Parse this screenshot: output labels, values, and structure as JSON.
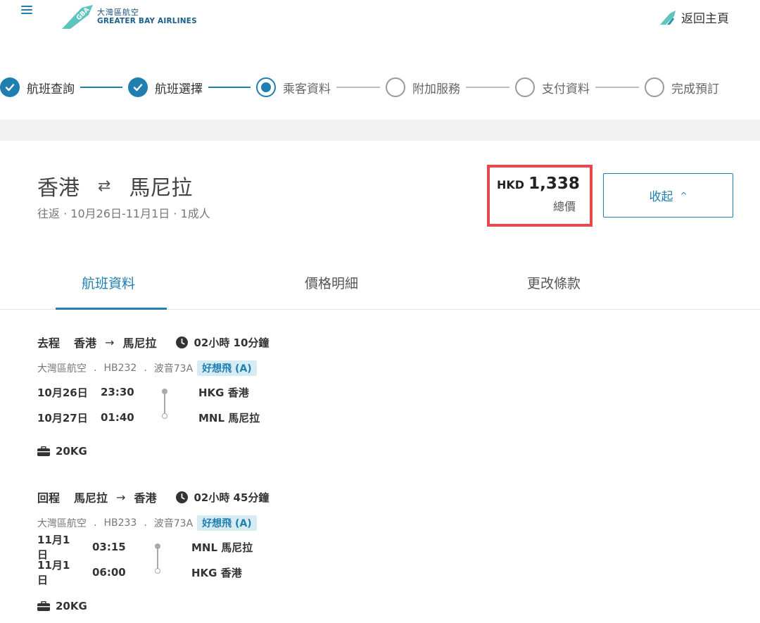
{
  "header": {
    "logo_cn": "大灣區航空",
    "logo_en": "GREATER BAY AIRLINES",
    "logo_mark": "GBA",
    "home_label": "返回主頁"
  },
  "stepper": {
    "steps": [
      {
        "label": "航班查詢",
        "state": "done"
      },
      {
        "label": "航班選擇",
        "state": "done"
      },
      {
        "label": "乘客資料",
        "state": "current"
      },
      {
        "label": "附加服務",
        "state": "pending"
      },
      {
        "label": "支付資料",
        "state": "pending"
      },
      {
        "label": "完成預訂",
        "state": "pending"
      }
    ]
  },
  "summary": {
    "origin": "香港",
    "swap_icon": "⇄",
    "destination": "馬尼拉",
    "subtitle": "往返 · 10月26日-11月1日 · 1成人",
    "currency": "HKD",
    "amount": "1,338",
    "price_label": "總價",
    "collapse_label": "收起",
    "collapse_chevron": "^"
  },
  "tabs": [
    {
      "label": "航班資料",
      "active": true
    },
    {
      "label": "價格明細",
      "active": false
    },
    {
      "label": "更改條款",
      "active": false
    }
  ],
  "outbound": {
    "direction": "去程",
    "from": "香港",
    "arrow": "→",
    "to": "馬尼拉",
    "duration": "02小時 10分鐘",
    "airline": "大灣區航空",
    "sep": ".",
    "flight_no": "HB232",
    "aircraft": "波音73A",
    "fare": "好想飛 (A)",
    "dep_date": "10月26日",
    "dep_time": "23:30",
    "dep_airport": "HKG 香港",
    "arr_date": "10月27日",
    "arr_time": "01:40",
    "arr_airport": "MNL 馬尼拉",
    "baggage": "20KG"
  },
  "inbound": {
    "direction": "回程",
    "from": "馬尼拉",
    "arrow": "→",
    "to": "香港",
    "duration": "02小時 45分鐘",
    "airline": "大灣區航空",
    "sep": ".",
    "flight_no": "HB233",
    "aircraft": "波音73A",
    "fare": "好想飛 (A)",
    "dep_date": "11月1日",
    "dep_time": "03:15",
    "dep_airport": "MNL 馬尼拉",
    "arr_date": "11月1日",
    "arr_time": "06:00",
    "arr_airport": "HKG 香港",
    "baggage": "20KG"
  },
  "colors": {
    "primary": "#1f7fb0",
    "highlight_border": "#e5484d",
    "badge_bg": "#d6ebf2"
  }
}
